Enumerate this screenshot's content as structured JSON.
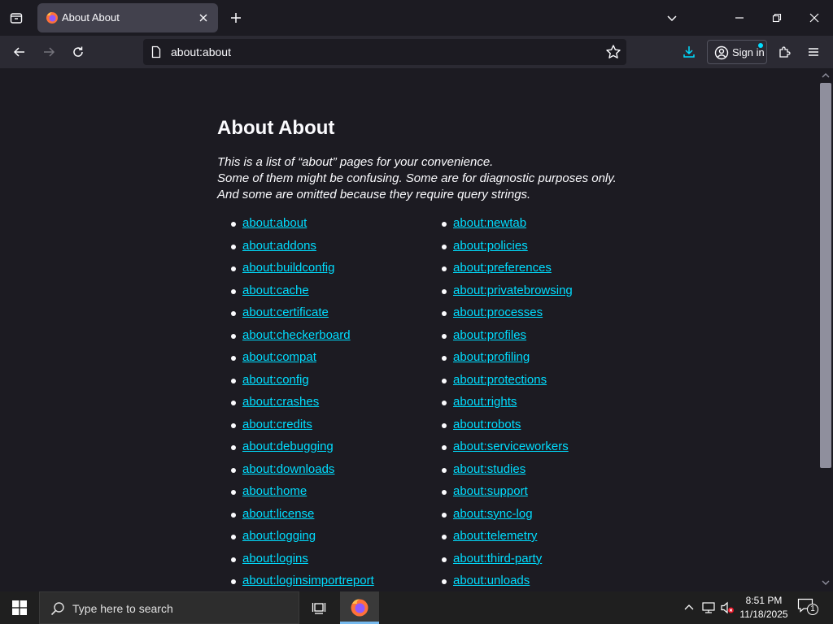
{
  "browser": {
    "tab": {
      "title": "About About"
    },
    "url": "about:about",
    "signin_label": "Sign in"
  },
  "page": {
    "title": "About About",
    "intro": [
      "This is a list of “about” pages for your convenience.",
      "Some of them might be confusing. Some are for diagnostic purposes only.",
      "And some are omitted because they require query strings."
    ],
    "links_left": [
      "about:about",
      "about:addons",
      "about:buildconfig",
      "about:cache",
      "about:certificate",
      "about:checkerboard",
      "about:compat",
      "about:config",
      "about:crashes",
      "about:credits",
      "about:debugging",
      "about:downloads",
      "about:home",
      "about:license",
      "about:logging",
      "about:logins",
      "about:loginsimportreport"
    ],
    "links_right": [
      "about:newtab",
      "about:policies",
      "about:preferences",
      "about:privatebrowsing",
      "about:processes",
      "about:profiles",
      "about:profiling",
      "about:protections",
      "about:rights",
      "about:robots",
      "about:serviceworkers",
      "about:studies",
      "about:support",
      "about:sync-log",
      "about:telemetry",
      "about:third-party",
      "about:unloads"
    ]
  },
  "taskbar": {
    "search_placeholder": "Type here to search",
    "time": "8:51 PM",
    "date": "11/18/2025",
    "notification_count": "1"
  },
  "colors": {
    "link": "#00ddff",
    "background": "#1c1b22",
    "toolbar": "#2b2a33"
  }
}
